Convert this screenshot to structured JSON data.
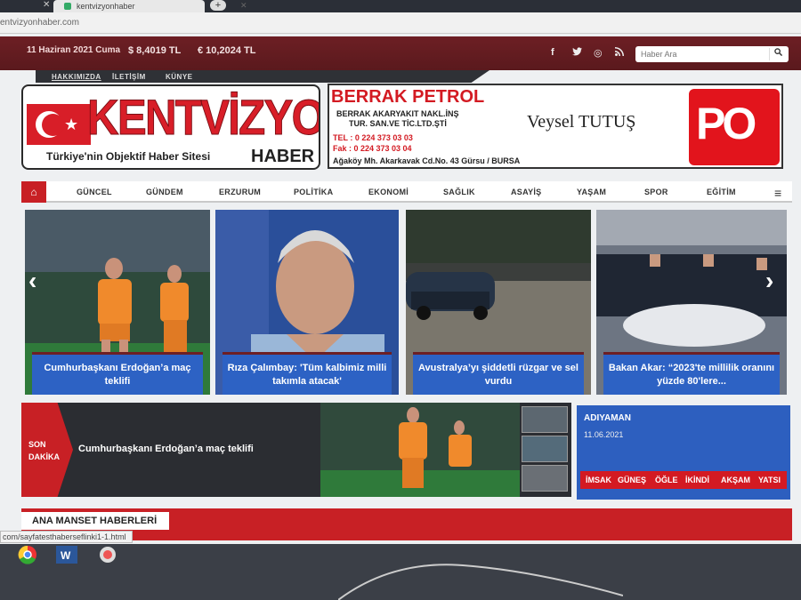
{
  "browser": {
    "tab_title": "kentvizyonhaber",
    "address": "entvizyonhaber.com",
    "status_link": "com/sayfatesthaberseflinki1-1.html"
  },
  "topbar": {
    "date": "11 Haziran 2021 Cuma",
    "usd": "$ 8,4019 TL",
    "eur": "€ 10,2024 TL",
    "search_placeholder": "Haber Ara",
    "social": [
      "f",
      "t",
      "◎",
      "ʃ"
    ]
  },
  "topnav": [
    "HAKKIMIZDA",
    "İLETİŞİM",
    "KÜNYE"
  ],
  "logo": {
    "word": "KENTVİZYON",
    "tagline": "Türkiye'nin Objektif Haber Sitesi",
    "haber": "HABER"
  },
  "ad": {
    "title": "BERRAK PETROL",
    "line1": "BERRAK AKARYAKIT NAKL.İNŞ",
    "line2": "TUR. SAN.VE TİC.LTD.ŞTİ",
    "tel": "TEL : 0 224 373 03 03",
    "fax": "Fak : 0 224 373 03 04",
    "address": "Ağaköy Mh. Akarkavak Cd.No. 43  Gürsu / BURSA",
    "name": "Veysel TUTUŞ",
    "badge": "PO"
  },
  "menu": [
    "GÜNCEL",
    "GÜNDEM",
    "ERZURUM",
    "POLİTİKA",
    "EKONOMİ",
    "SAĞLIK",
    "ASAYİŞ",
    "YAŞAM",
    "SPOR",
    "EĞİTİM"
  ],
  "slides": [
    {
      "caption": "Cumhurbaşkanı Erdoğan’a maç teklifi"
    },
    {
      "caption": "Rıza Çalımbay: 'Tüm kalbimiz milli takımla atacak'"
    },
    {
      "caption": "Avustralya’yı şiddetli rüzgar ve sel vurdu"
    },
    {
      "caption": "Bakan Akar: “2023'te millilik oranını yüzde 80'lere..."
    }
  ],
  "breaking": {
    "label_1": "SON",
    "label_2": "DAKİKA",
    "headline": "Cumhurbaşkanı Erdoğan’a maç teklifi"
  },
  "prayer": {
    "city": "ADIYAMAN",
    "date": "11.06.2021",
    "times": [
      "İMSAK",
      "GÜNEŞ",
      "ÖĞLE",
      "İKİNDİ",
      "AKŞAM",
      "YATSI"
    ]
  },
  "section": {
    "title": "ANA MANSET HABERLERİ"
  },
  "colors": {
    "brand_red": "#c82025",
    "topbar": "#6d1f24",
    "caption_blue": "#2d62c4"
  }
}
